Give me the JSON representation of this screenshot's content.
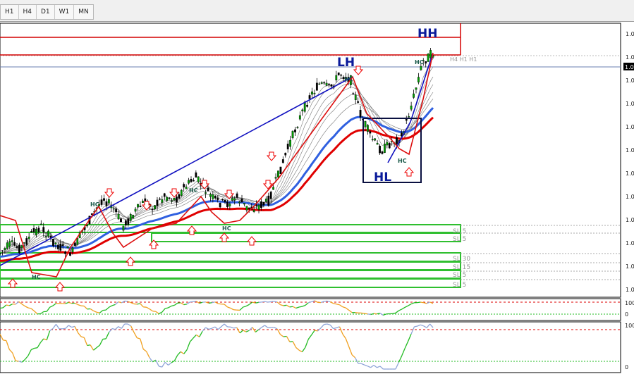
{
  "toolbar": {
    "timeframes": [
      "H1",
      "H4",
      "D1",
      "W1",
      "MN"
    ]
  },
  "annotations": {
    "hh": "HH",
    "lh": "LH",
    "hl": "HL"
  },
  "pattern_marks": [
    "HC",
    "HC",
    "HC",
    "HC",
    "HC",
    "HC",
    "HC"
  ],
  "price_axis": {
    "labels": [
      "1.0",
      "1.0",
      "1.0",
      "1.0",
      "1.0",
      "1.0",
      "1.0",
      "1.0",
      "1.0",
      "1.0",
      "1.0",
      "1.0"
    ],
    "current": "1.0"
  },
  "zone_labels": [
    "SL 5",
    "SL 5",
    "SL 30",
    "SL 15",
    "SL 5",
    "SL 5"
  ],
  "hidden_label": "H4 H1 H1",
  "osc1_axis": {
    "top": "100",
    "bottom": "0"
  },
  "osc2_axis": {
    "top": "100",
    "bottom": "0"
  },
  "colors": {
    "bull": "#00a000",
    "bear": "#000000",
    "resistance": "#d40000",
    "support": "#2fbf2f",
    "ema_red": "#e00000",
    "ema_blue": "#3060e0",
    "trend_blue": "#1010c0",
    "osc_green": "#22bb22",
    "osc_orange": "#f0a020",
    "osc_blue": "#8ea4d8"
  },
  "chart_data": {
    "type": "line",
    "series": [
      {
        "values": [
          0.1,
          0.14,
          0.12,
          0.18,
          0.22,
          0.16,
          0.12,
          0.1,
          0.2,
          0.27,
          0.35,
          0.3,
          0.22,
          0.28,
          0.33,
          0.31,
          0.36,
          0.34,
          0.4,
          0.44,
          0.38,
          0.33,
          0.32,
          0.35,
          0.3,
          0.31,
          0.33,
          0.45,
          0.58,
          0.7,
          0.8,
          0.86,
          0.84,
          0.91,
          0.88,
          0.72,
          0.62,
          0.56,
          0.6,
          0.62,
          0.78,
          0.96,
          1.0
        ]
      }
    ]
  }
}
